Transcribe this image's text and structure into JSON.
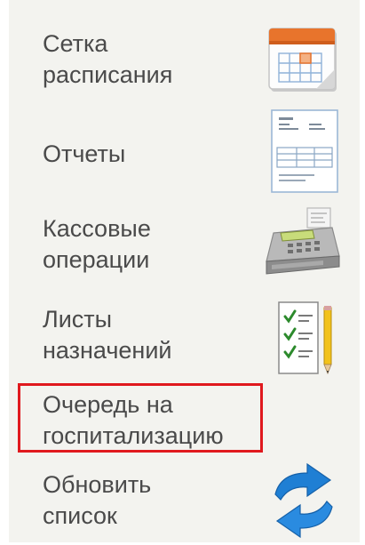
{
  "menu": {
    "items": [
      {
        "label_line1": "Сетка",
        "label_line2": "расписания",
        "icon": "calendar-grid-icon"
      },
      {
        "label_line1": "Отчеты",
        "label_line2": "",
        "icon": "report-document-icon"
      },
      {
        "label_line1": "Кассовые",
        "label_line2": "операции",
        "icon": "cash-register-icon"
      },
      {
        "label_line1": "Листы",
        "label_line2": "назначений",
        "icon": "checklist-pencil-icon"
      },
      {
        "label_line1": "Очередь на",
        "label_line2": "госпитализацию",
        "icon": "none"
      },
      {
        "label_line1": "Обновить",
        "label_line2": "список",
        "icon": "refresh-arrows-icon"
      }
    ]
  },
  "colors": {
    "panel_bg": "#f3f3ef",
    "text": "#4a4a4a",
    "highlight_border": "#e0191e",
    "refresh_blue": "#1f7fd4"
  }
}
